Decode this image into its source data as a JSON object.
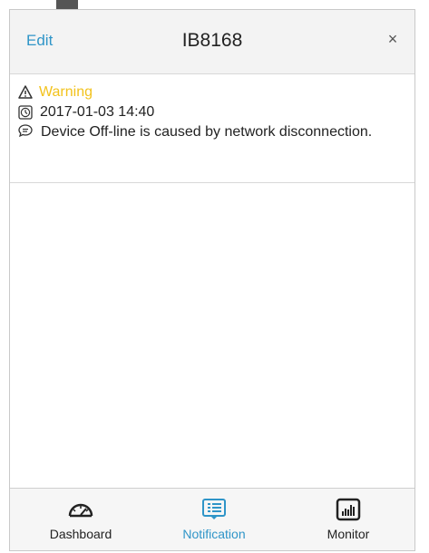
{
  "header": {
    "edit_label": "Edit",
    "title": "IB8168",
    "close_label": "×"
  },
  "notification": {
    "level": "Warning",
    "timestamp": "2017-01-03 14:40",
    "message": "Device Off-line is caused by network disconnection."
  },
  "tabs": [
    {
      "label": "Dashboard",
      "icon": "speedometer-icon",
      "active": false
    },
    {
      "label": "Notification",
      "icon": "notification-list-icon",
      "active": true
    },
    {
      "label": "Monitor",
      "icon": "bar-chart-icon",
      "active": false
    }
  ],
  "colors": {
    "accent": "#2f95c8",
    "warning": "#f2c21c"
  }
}
